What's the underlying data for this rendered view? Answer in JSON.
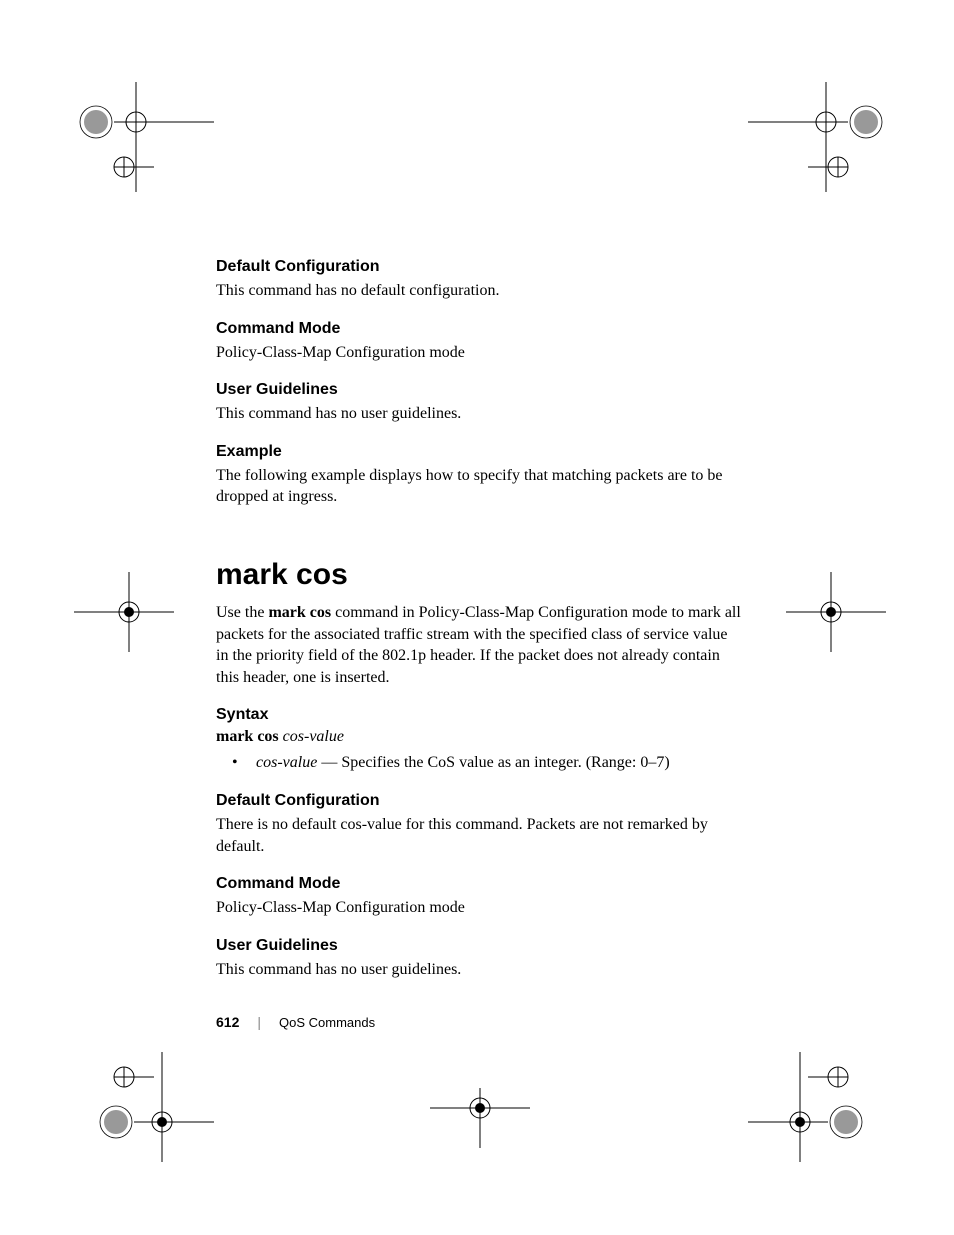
{
  "sections": {
    "default_config_1": {
      "heading": "Default Configuration",
      "body": "This command has no default configuration."
    },
    "command_mode_1": {
      "heading": "Command Mode",
      "body": "Policy-Class-Map Configuration mode"
    },
    "user_guidelines_1": {
      "heading": "User Guidelines",
      "body": "This command has no user guidelines."
    },
    "example": {
      "heading": "Example",
      "body": "The following example displays how to specify that matching packets are to be dropped at ingress."
    }
  },
  "command": {
    "title": "mark cos",
    "intro_pre": "Use the ",
    "intro_bold": "mark cos",
    "intro_post": " command in Policy-Class-Map Configuration mode to mark all packets for the associated traffic stream with the specified class of service value in the priority field of the 802.1p header. If the packet does not already contain this header, one is inserted."
  },
  "syntax": {
    "heading": "Syntax",
    "cmd_bold": "mark cos ",
    "cmd_italic": "cos-value",
    "bullet_italic": "cos-value",
    "bullet_rest": " — Specifies the CoS value as an integer. (Range: 0–7)"
  },
  "sections2": {
    "default_config_2": {
      "heading": "Default Configuration",
      "body": "There is no default cos-value for this command. Packets are not remarked by default."
    },
    "command_mode_2": {
      "heading": "Command Mode",
      "body": "Policy-Class-Map Configuration mode"
    },
    "user_guidelines_2": {
      "heading": "User Guidelines",
      "body": "This command has no user guidelines."
    }
  },
  "footer": {
    "page": "612",
    "section": "QoS Commands"
  }
}
